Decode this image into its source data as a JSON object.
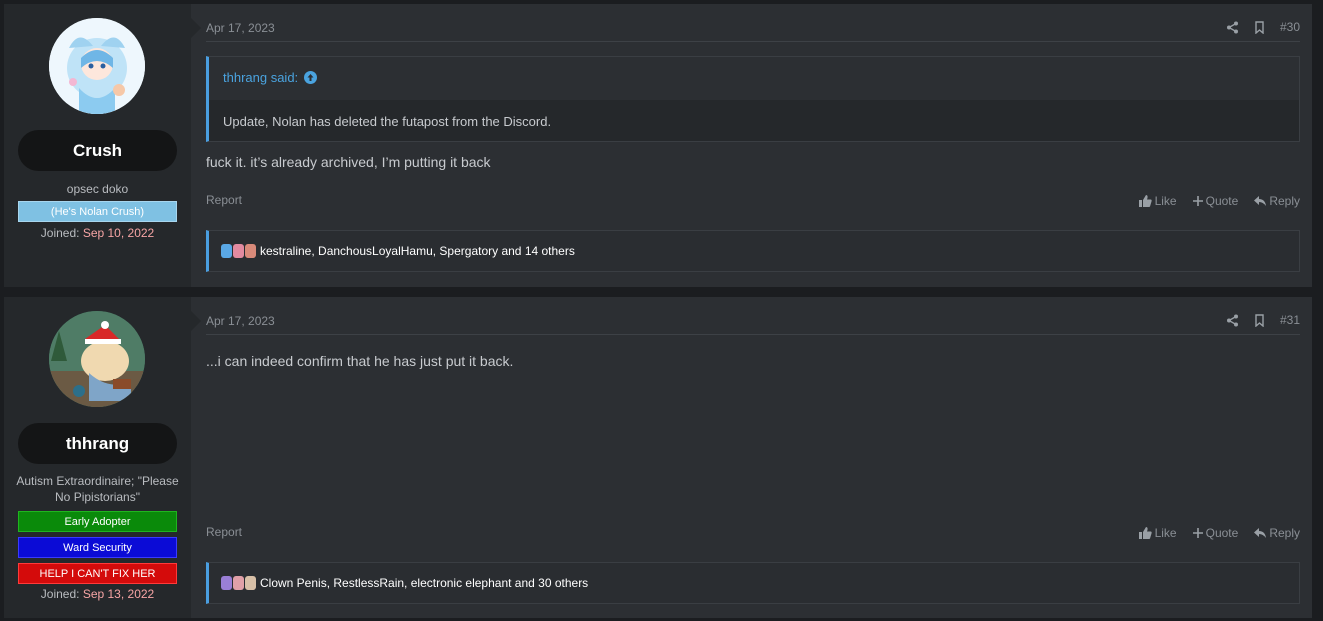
{
  "posts": [
    {
      "user": {
        "name": "Crush",
        "title": "opsec doko",
        "banners": [
          {
            "text": "(He's Nolan Crush)",
            "bg": "#7fc1e3",
            "fg": "#ffffff",
            "border": "#a8d6ee"
          }
        ],
        "joined_label": "Joined:",
        "joined_date": "Sep 10, 2022"
      },
      "date": "Apr 17, 2023",
      "number": "#30",
      "quote": {
        "author": "thhrang said:",
        "text": "Update, Nolan has deleted the futapost from the Discord."
      },
      "message": "fuck it. it’s already archived, I’m putting it back",
      "report_label": "Report",
      "actions": {
        "like": "Like",
        "quote": "Quote",
        "reply": "Reply"
      },
      "reactions_text": "kestraline, DanchousLoyalHamu, Spergatory and 14 others"
    },
    {
      "user": {
        "name": "thhrang",
        "title": "Autism Extraordinaire; \"Please No Pipistorians\"",
        "banners": [
          {
            "text": "Early Adopter",
            "bg": "#0a8a0a",
            "fg": "#ffffff",
            "border": "#1fb51f"
          },
          {
            "text": "Ward Security",
            "bg": "#0b0bd6",
            "fg": "#ffffff",
            "border": "#3a3aff"
          },
          {
            "text": "HELP I CAN'T FIX HER",
            "bg": "#d40b0b",
            "fg": "#ffffff",
            "border": "#ff3a3a"
          }
        ],
        "joined_label": "Joined:",
        "joined_date": "Sep 13, 2022"
      },
      "date": "Apr 17, 2023",
      "number": "#31",
      "message": "...i can indeed confirm that he has just put it back.",
      "report_label": "Report",
      "actions": {
        "like": "Like",
        "quote": "Quote",
        "reply": "Reply"
      },
      "reactions_text": "Clown Penis, RestlessRain, electronic elephant and 30 others"
    }
  ],
  "colors": {
    "accent": "#4a9ee0",
    "join_date": "#f7a5a5",
    "post_bg": "#2c2f33",
    "user_bg": "#25282b"
  },
  "icons": [
    "share-icon",
    "bookmark-icon",
    "thumbs-up-icon",
    "plus-icon",
    "reply-icon",
    "arrow-up-circle-icon"
  ]
}
